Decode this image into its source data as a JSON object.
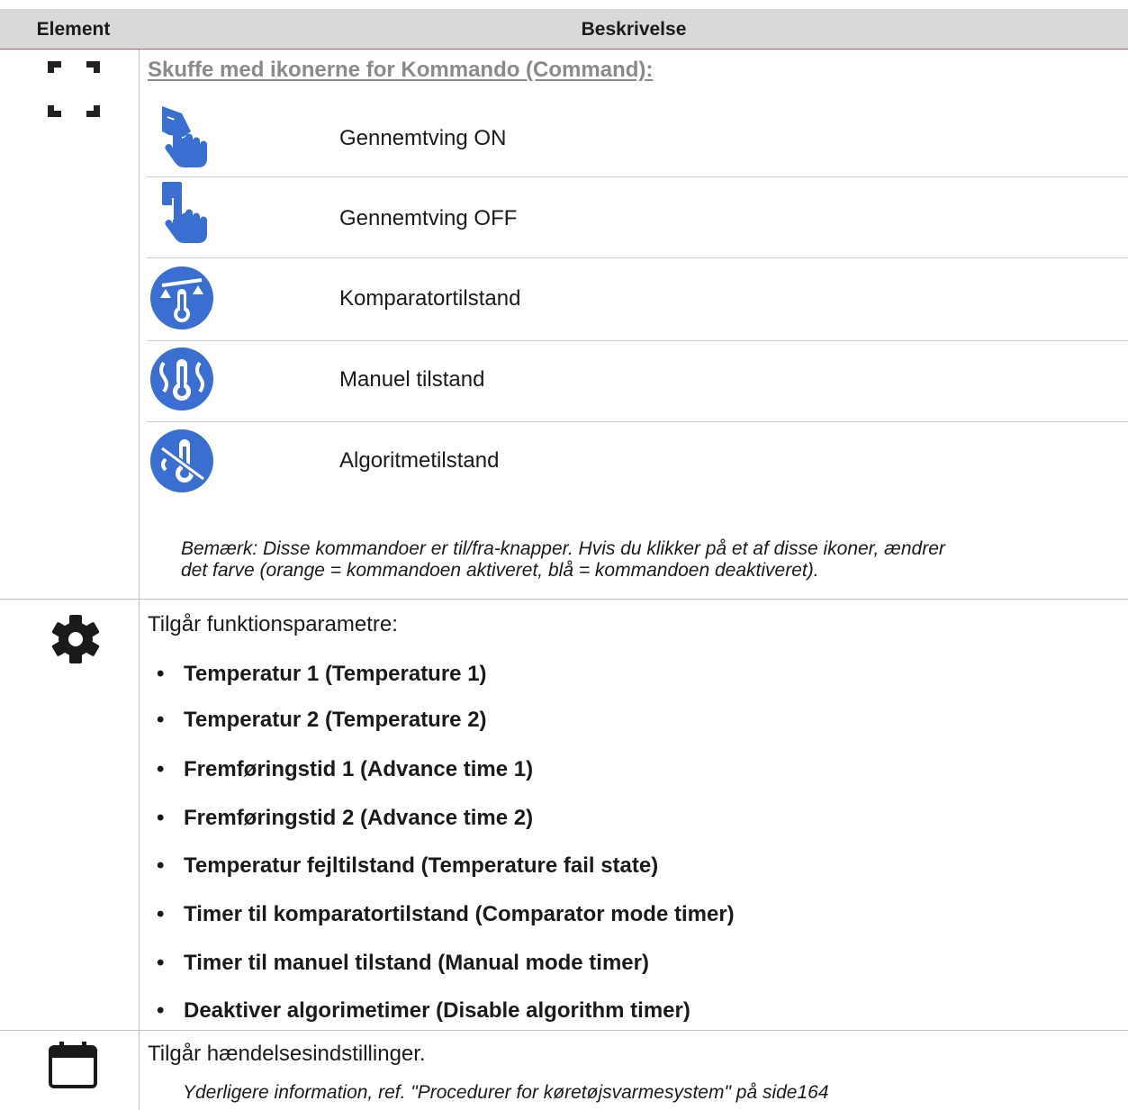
{
  "table": {
    "header": {
      "element": "Element",
      "description": "Beskrivelse"
    }
  },
  "rows": {
    "drawer": {
      "icon": "fullscreen-corners-icon",
      "title": "Skuffe med ikonerne for Kommando (Command):",
      "commands": [
        {
          "icon": "force-on-hand-icon",
          "label": "Gennemtving ON"
        },
        {
          "icon": "force-off-hand-icon",
          "label": "Gennemtving OFF"
        },
        {
          "icon": "comparator-mode-icon",
          "label": "Komparatortilstand"
        },
        {
          "icon": "manual-mode-icon",
          "label": "Manuel tilstand"
        },
        {
          "icon": "algorithm-mode-icon",
          "label": "Algoritmetilstand"
        }
      ],
      "note_line1": "Bemærk: Disse kommandoer er til/fra-knapper. Hvis du klikker på et af disse ikoner, ændrer",
      "note_line2": "det farve (orange = kommandoen aktiveret, blå = kommandoen deaktiveret)."
    },
    "settings": {
      "icon": "gear-icon",
      "intro": "Tilgår funktionsparametre:",
      "bullets": [
        "Temperatur 1 (Temperature 1)",
        "Temperatur 2 (Temperature 2)",
        "Fremføringstid 1 (Advance time 1)",
        "Fremføringstid 2 (Advance time 2)",
        "Temperatur fejltilstand (Temperature fail state)",
        "Timer til komparatortilstand (Comparator mode timer)",
        "Timer til manuel tilstand (Manual mode timer)",
        "Deaktiver algorimetimer (Disable algorithm timer)"
      ]
    },
    "events": {
      "icon": "calendar-icon",
      "intro": "Tilgår hændelsesindstillinger.",
      "reference": "Yderligere information, ref. \"Procedurer for køretøjsvarmesystem\" på side164"
    }
  },
  "colors": {
    "icon_blue": "#3a6fd1",
    "header_bg": "#d9d9d9",
    "title_gray": "#8a8a8a",
    "accent_line": "#cf5a6a"
  }
}
